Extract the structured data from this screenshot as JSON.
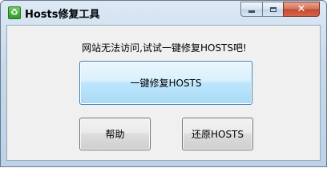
{
  "window": {
    "title": "Hosts修复工具",
    "app_icon": "recycle-icon",
    "controls": {
      "minimize": "minimize-icon",
      "maximize": "maximize-icon",
      "close_glyph": "✕"
    }
  },
  "main": {
    "message": "网站无法访问,试试一键修复HOSTS吧!",
    "repair_button": "一键修复HOSTS",
    "help_button": "帮助",
    "restore_button": "还原HOSTS"
  },
  "colors": {
    "primary_button": "#bee6fd",
    "close_button": "#c24a2e"
  }
}
